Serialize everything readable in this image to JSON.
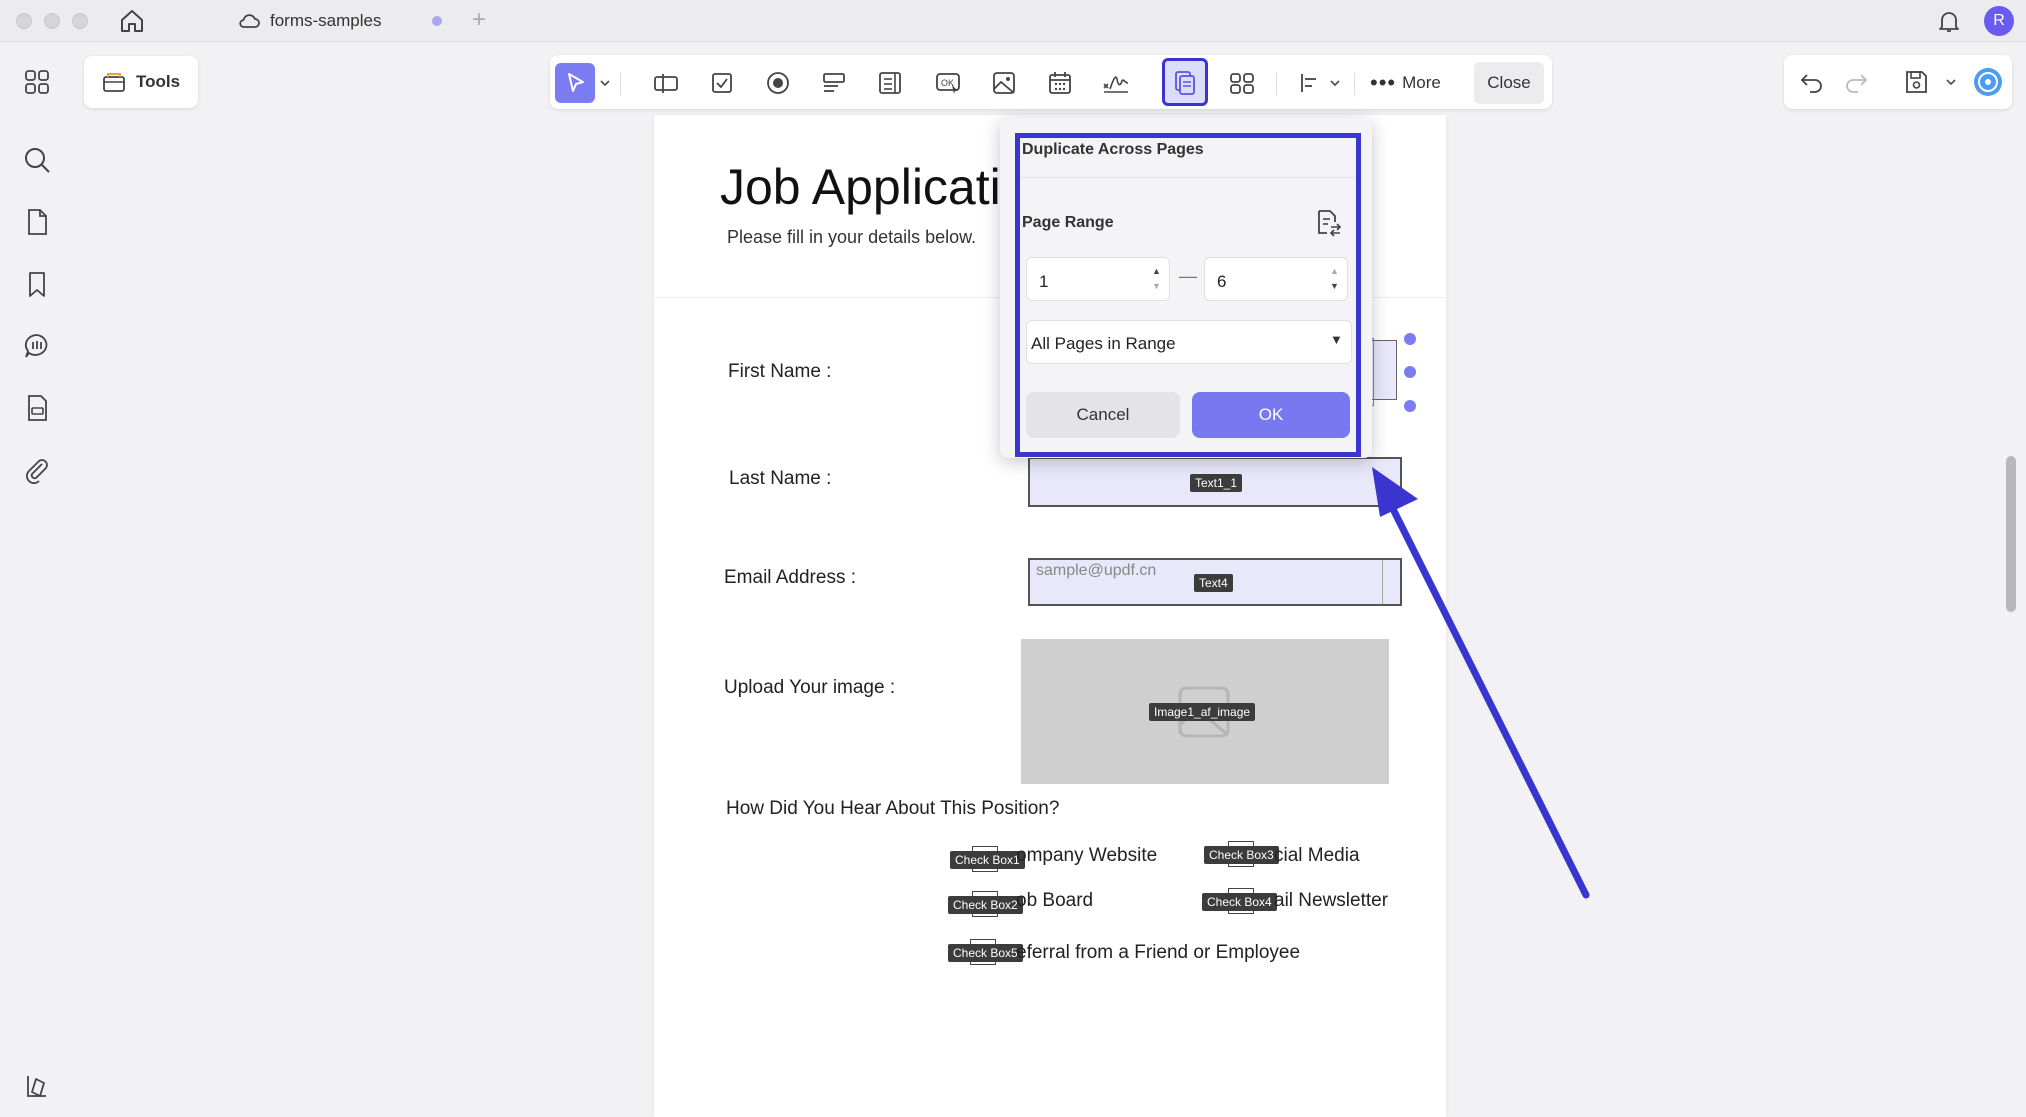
{
  "window": {
    "tab_title": "forms-samples",
    "avatar_initial": "R"
  },
  "sidebar": {
    "icons": [
      "grid-icon",
      "search-icon",
      "page-icon",
      "bookmark-icon",
      "comment-icon",
      "form-icon",
      "attachment-icon",
      "layers-icon"
    ]
  },
  "toolbar": {
    "tools_label": "Tools",
    "more_label": "More",
    "close_label": "Close"
  },
  "document": {
    "title": "Job Applicatio",
    "subtitle": "Please fill in your details below.",
    "first_name_label": "First Name :",
    "last_name_label": "Last Name :",
    "last_name_tag": "Text1_1",
    "email_label": "Email Address :",
    "email_placeholder": "sample@updf.cn",
    "email_tag": "Text4",
    "upload_label": "Upload Your image :",
    "image_tag": "Image1_af_image",
    "question": "How Did You Hear About This Position?",
    "checkboxes": [
      {
        "tag": "Check Box1",
        "text": "ompany Website"
      },
      {
        "tag": "Check Box2",
        "text": "ob Board"
      },
      {
        "tag": "Check Box3",
        "text": "cial Media"
      },
      {
        "tag": "Check Box4",
        "text": "ail Newsletter"
      },
      {
        "tag": "Check Box5",
        "text": "eferral from a Friend or Employee"
      }
    ]
  },
  "popup": {
    "title": "Duplicate Across Pages",
    "range_label": "Page Range",
    "from_value": "1",
    "to_value": "6",
    "dash": "—",
    "select_value": "All Pages in Range",
    "cancel_label": "Cancel",
    "ok_label": "OK"
  },
  "colors": {
    "accent": "#7878f0",
    "highlight": "#3b35d0"
  }
}
